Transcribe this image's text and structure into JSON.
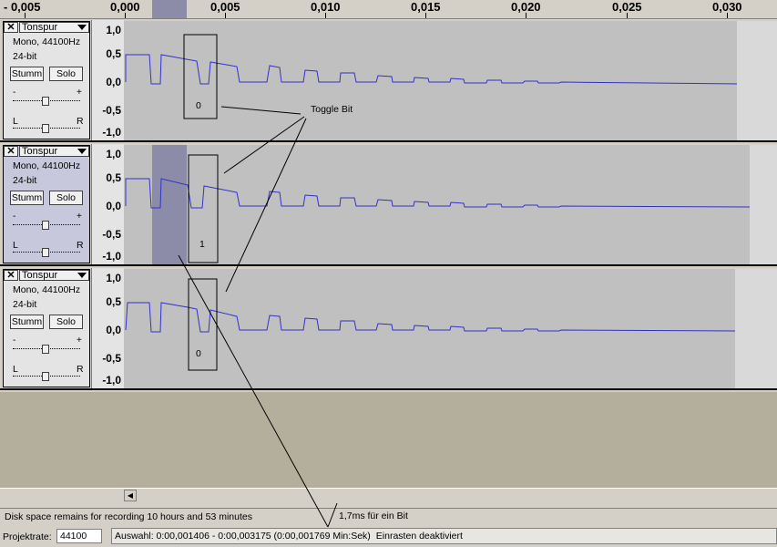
{
  "ruler": {
    "labels": [
      "- 0,005",
      "0,000",
      "0,005",
      "0,010",
      "0,015",
      "0,020",
      "0,025",
      "0,030"
    ]
  },
  "tracks": [
    {
      "name": "Tonspur",
      "info_line1": "Mono, 44100Hz",
      "info_line2": "24-bit",
      "mute_label": "Stumm",
      "solo_label": "Solo",
      "gain_minus": "-",
      "gain_plus": "+",
      "pan_left": "L",
      "pan_right": "R",
      "scale": [
        "1,0",
        "0,5",
        "0,0",
        "-0,5",
        "-1,0"
      ],
      "bit_label": "0",
      "selected": false
    },
    {
      "name": "Tonspur",
      "info_line1": "Mono, 44100Hz",
      "info_line2": "24-bit",
      "mute_label": "Stumm",
      "solo_label": "Solo",
      "gain_minus": "-",
      "gain_plus": "+",
      "pan_left": "L",
      "pan_right": "R",
      "scale": [
        "1,0",
        "0,5",
        "0,0",
        "-0,5",
        "-1,0"
      ],
      "bit_label": "1",
      "selected": true
    },
    {
      "name": "Tonspur",
      "info_line1": "Mono, 44100Hz",
      "info_line2": "24-bit",
      "mute_label": "Stumm",
      "solo_label": "Solo",
      "gain_minus": "-",
      "gain_plus": "+",
      "pan_left": "L",
      "pan_right": "R",
      "scale": [
        "1,0",
        "0,5",
        "0,0",
        "-0,5",
        "-1,0"
      ],
      "bit_label": "0",
      "selected": false
    }
  ],
  "annotations": {
    "toggle_bit": "Toggle Bit",
    "duration": "1,7ms für ein Bit"
  },
  "status": {
    "disk_space": "Disk space remains for recording 10 hours and 53 minutes",
    "rate_label": "Projektrate:",
    "rate_value": "44100",
    "selection": "Auswahl: 0:00,001406 - 0:00,003175 (0:00,001769 Min:Sek)",
    "snap": "Einrasten deaktiviert"
  },
  "colors": {
    "waveform": "#3232c8",
    "selection": "#8c8ca8",
    "background": "#d4d0c8"
  },
  "icons": {
    "close": "close-icon",
    "menu": "chevron-down-icon",
    "scroll_left": "scroll-left-icon"
  }
}
